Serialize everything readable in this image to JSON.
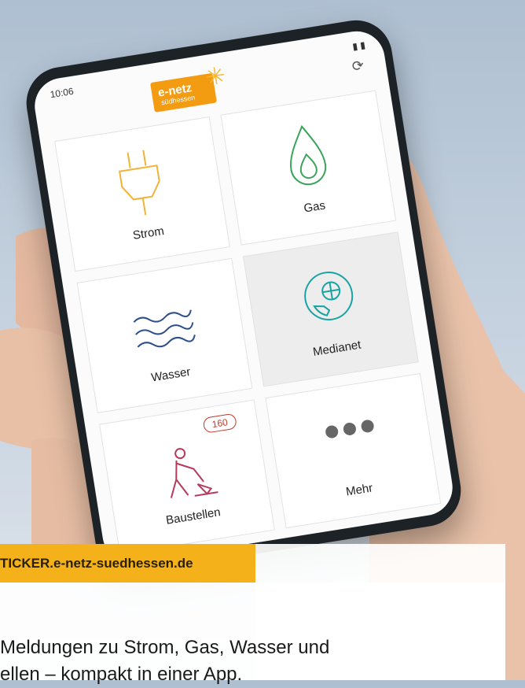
{
  "status_bar": {
    "time": "10:06"
  },
  "logo": {
    "line1": "e-netz",
    "line2": "südhessen"
  },
  "tiles": [
    {
      "label": "Strom"
    },
    {
      "label": "Gas"
    },
    {
      "label": "Wasser"
    },
    {
      "label": "Medianet"
    },
    {
      "label": "Baustellen",
      "badge": "160"
    },
    {
      "label": "Mehr"
    }
  ],
  "banner": {
    "url": "TICKER.e-netz-suedhessen.de"
  },
  "caption": {
    "line1": "Meldungen zu Strom, Gas, Wasser und",
    "line2": "ellen – kompakt in einer App."
  },
  "colors": {
    "accent": "#f5b11a",
    "strom": "#f3b338",
    "gas": "#3aa35c",
    "wasser": "#2d4f8a",
    "medianet": "#1aa3a3",
    "baustellen": "#b73a5c"
  },
  "icons": [
    "plug-icon",
    "flame-icon",
    "waves-icon",
    "phone-globe-icon",
    "worker-icon",
    "dots-icon",
    "sync-icon"
  ]
}
